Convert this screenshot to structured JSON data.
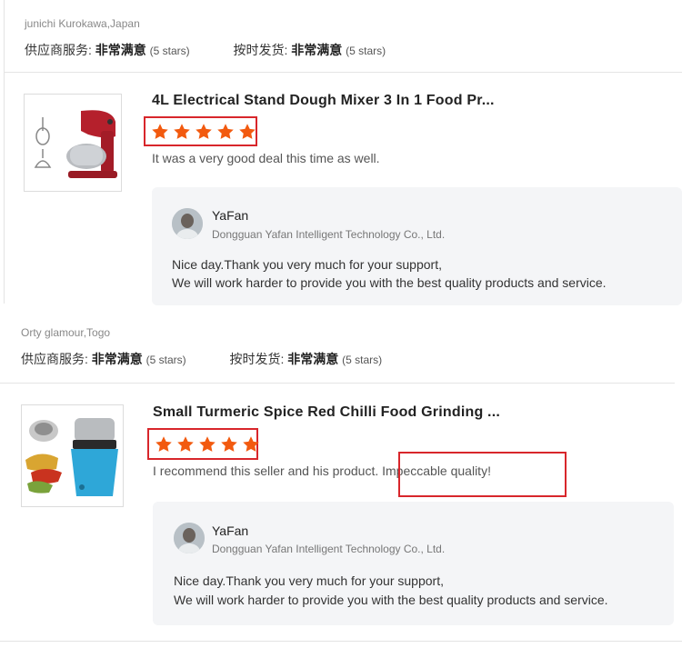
{
  "reviews": [
    {
      "reviewer": "junichi Kurokawa,Japan",
      "supplier_service_label": "供应商服务:",
      "supplier_service_value": "非常满意",
      "supplier_service_stars": "(5 stars)",
      "on_time_label": "按时发货:",
      "on_time_value": "非常满意",
      "on_time_stars": "(5 stars)",
      "product_title": "4L Electrical Stand Dough Mixer 3 In 1 Food Pr...",
      "rating": 5,
      "comment": "It was a very good deal this time as well.",
      "reply": {
        "name": "YaFan",
        "company": "Dongguan Yafan Intelligent Technology Co., Ltd.",
        "line1": "Nice day.Thank you very much for your support,",
        "line2": "We will work harder to provide you with the best quality products and service."
      }
    },
    {
      "reviewer": "Orty glamour,Togo",
      "supplier_service_label": "供应商服务:",
      "supplier_service_value": "非常满意",
      "supplier_service_stars": "(5 stars)",
      "on_time_label": "按时发货:",
      "on_time_value": "非常满意",
      "on_time_stars": "(5 stars)",
      "product_title": "Small Turmeric Spice Red Chilli Food Grinding ...",
      "rating": 5,
      "comment": "I recommend this seller and his product. Impeccable quality!",
      "reply": {
        "name": "YaFan",
        "company": "Dongguan Yafan Intelligent Technology Co., Ltd.",
        "line1": "Nice day.Thank you very much for your support,",
        "line2": "We will work harder to provide you with the best quality products and service."
      }
    }
  ],
  "colors": {
    "star": "#f25a0f",
    "highlight": "#d8262b",
    "reply_bg": "#f4f5f7"
  },
  "icons": {
    "star": "star-icon",
    "avatar": "avatar"
  }
}
